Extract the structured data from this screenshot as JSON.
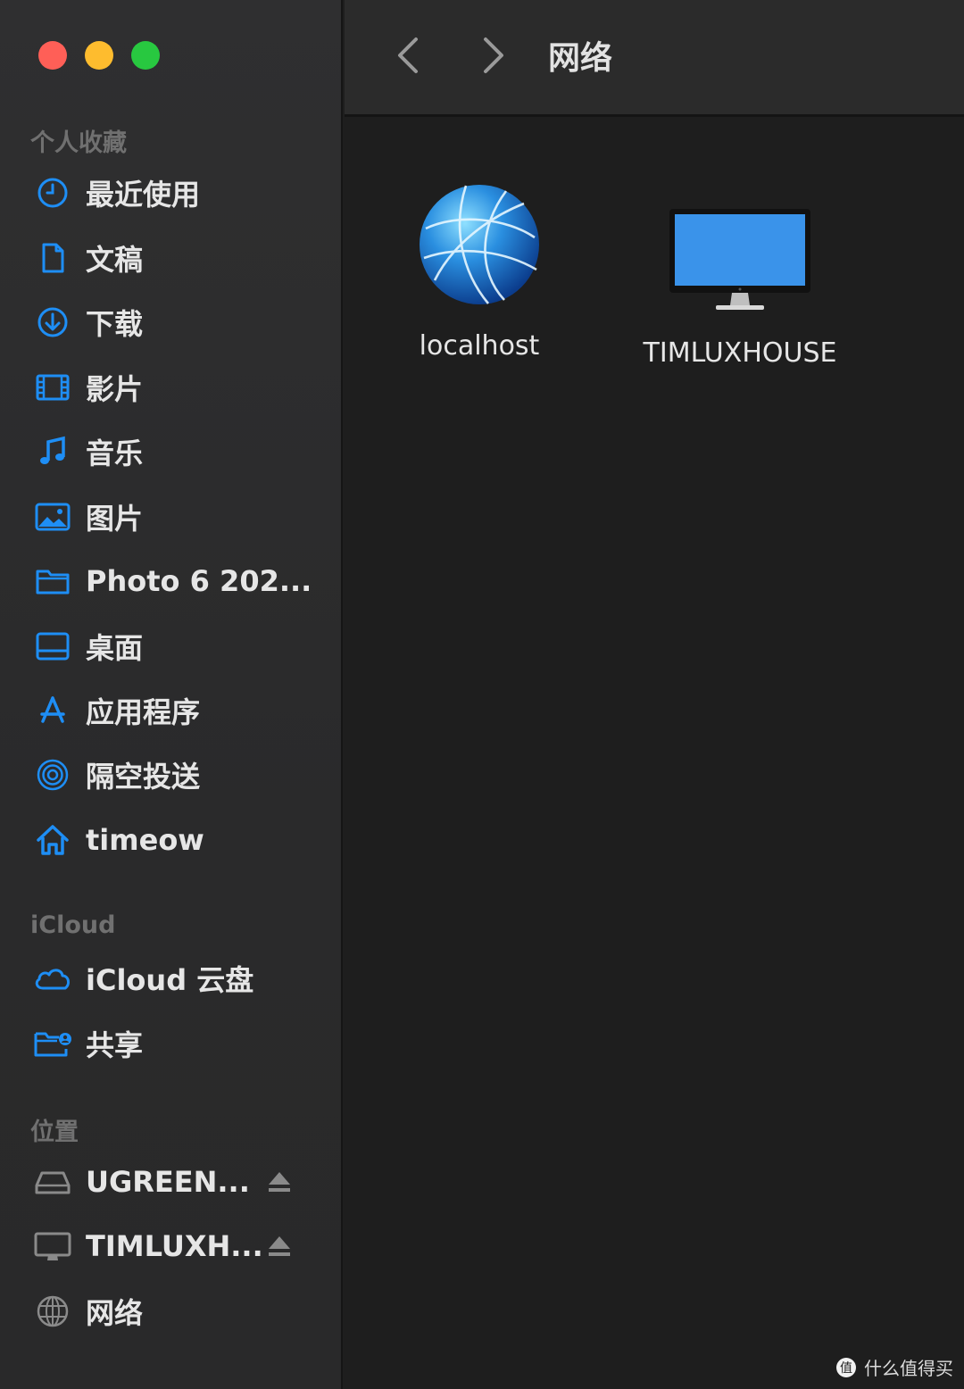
{
  "window": {
    "title": "网络"
  },
  "colors": {
    "accent": "#1e8ef5",
    "sidebar_bg": "#2e2e2f",
    "content_bg": "#1e1e1e"
  },
  "sidebar": {
    "favorites_header": "个人收藏",
    "favorites": [
      {
        "label": "最近使用",
        "icon": "clock-icon"
      },
      {
        "label": "文稿",
        "icon": "document-icon"
      },
      {
        "label": "下载",
        "icon": "download-icon"
      },
      {
        "label": "影片",
        "icon": "film-icon"
      },
      {
        "label": "音乐",
        "icon": "music-icon"
      },
      {
        "label": "图片",
        "icon": "photo-icon"
      },
      {
        "label": "Photo 6 202...",
        "icon": "folder-icon"
      },
      {
        "label": "桌面",
        "icon": "desktop-icon"
      },
      {
        "label": "应用程序",
        "icon": "applications-icon"
      },
      {
        "label": "隔空投送",
        "icon": "airdrop-icon"
      },
      {
        "label": "timeow",
        "icon": "home-icon"
      }
    ],
    "icloud_header": "iCloud",
    "icloud": [
      {
        "label": "iCloud 云盘",
        "icon": "cloud-icon"
      },
      {
        "label": "共享",
        "icon": "shared-folder-icon"
      }
    ],
    "locations_header": "位置",
    "locations": [
      {
        "label": "UGREEN...",
        "icon": "drive-icon",
        "eject": true
      },
      {
        "label": "TIMLUXH...",
        "icon": "computer-icon",
        "eject": true
      },
      {
        "label": "网络",
        "icon": "network-globe-icon"
      }
    ]
  },
  "content": {
    "items": [
      {
        "name": "localhost",
        "icon": "network-globe-icon"
      },
      {
        "name": "TIMLUXHOUSE",
        "icon": "imac-icon"
      }
    ]
  },
  "watermark": {
    "text": "什么值得买"
  }
}
